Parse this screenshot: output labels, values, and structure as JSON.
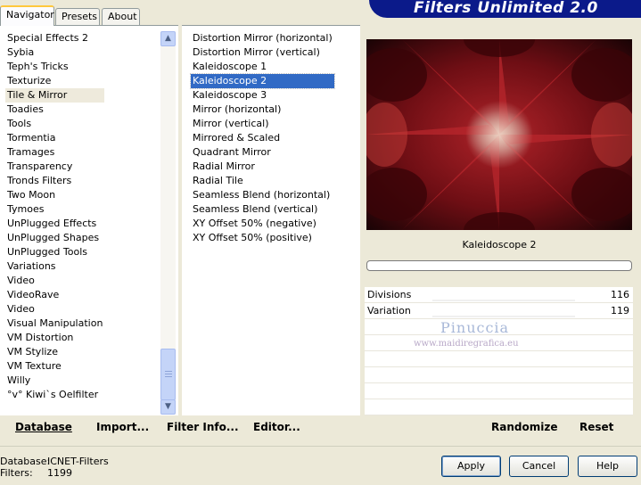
{
  "tabs": [
    "Navigator",
    "Presets",
    "About"
  ],
  "brand": "Filters Unlimited 2.0",
  "categories": [
    "Special Effects 2",
    "Sybia",
    "Teph's Tricks",
    "Texturize",
    "Tile & Mirror",
    "Toadies",
    "Tools",
    "Tormentia",
    "Tramages",
    "Transparency",
    "Tronds Filters",
    "Two Moon",
    "Tymoes",
    "UnPlugged Effects",
    "UnPlugged Shapes",
    "UnPlugged Tools",
    "Variations",
    "Video",
    "VideoRave",
    "Video",
    "Visual Manipulation",
    "VM Distortion",
    "VM Stylize",
    "VM Texture",
    "Willy",
    "°v° Kiwi`s Oelfilter"
  ],
  "selected_category": "Tile & Mirror",
  "filters": [
    "Distortion Mirror (horizontal)",
    "Distortion Mirror (vertical)",
    "Kaleidoscope 1",
    "Kaleidoscope 2",
    "Kaleidoscope 3",
    "Mirror (horizontal)",
    "Mirror (vertical)",
    "Mirrored & Scaled",
    "Quadrant Mirror",
    "Radial Mirror",
    "Radial Tile",
    "Seamless Blend (horizontal)",
    "Seamless Blend (vertical)",
    "XY Offset 50% (negative)",
    "XY Offset 50% (positive)"
  ],
  "selected_filter": "Kaleidoscope 2",
  "actions": {
    "database": "Database",
    "import": "Import...",
    "filter_info": "Filter Info...",
    "editor": "Editor...",
    "randomize": "Randomize",
    "reset": "Reset"
  },
  "filter_title": "Kaleidoscope 2",
  "params": [
    {
      "label": "Divisions",
      "value": "116"
    },
    {
      "label": "Variation",
      "value": "119"
    }
  ],
  "watermark": {
    "name": "Pinuccia",
    "url": "www.maidiregrafica.eu"
  },
  "footer": {
    "database_label": "Database:",
    "database_value": "ICNET-Filters",
    "filters_label": "Filters:",
    "filters_value": "1199"
  },
  "buttons": {
    "apply": "Apply",
    "cancel": "Cancel",
    "help": "Help"
  },
  "icons": {
    "scroll_up": "chevron-up-icon",
    "scroll_down": "chevron-down-icon"
  },
  "colors": {
    "brand_bg": "#0b1a8a",
    "selection": "#316ac5",
    "preview_red": "#9a1c22"
  }
}
